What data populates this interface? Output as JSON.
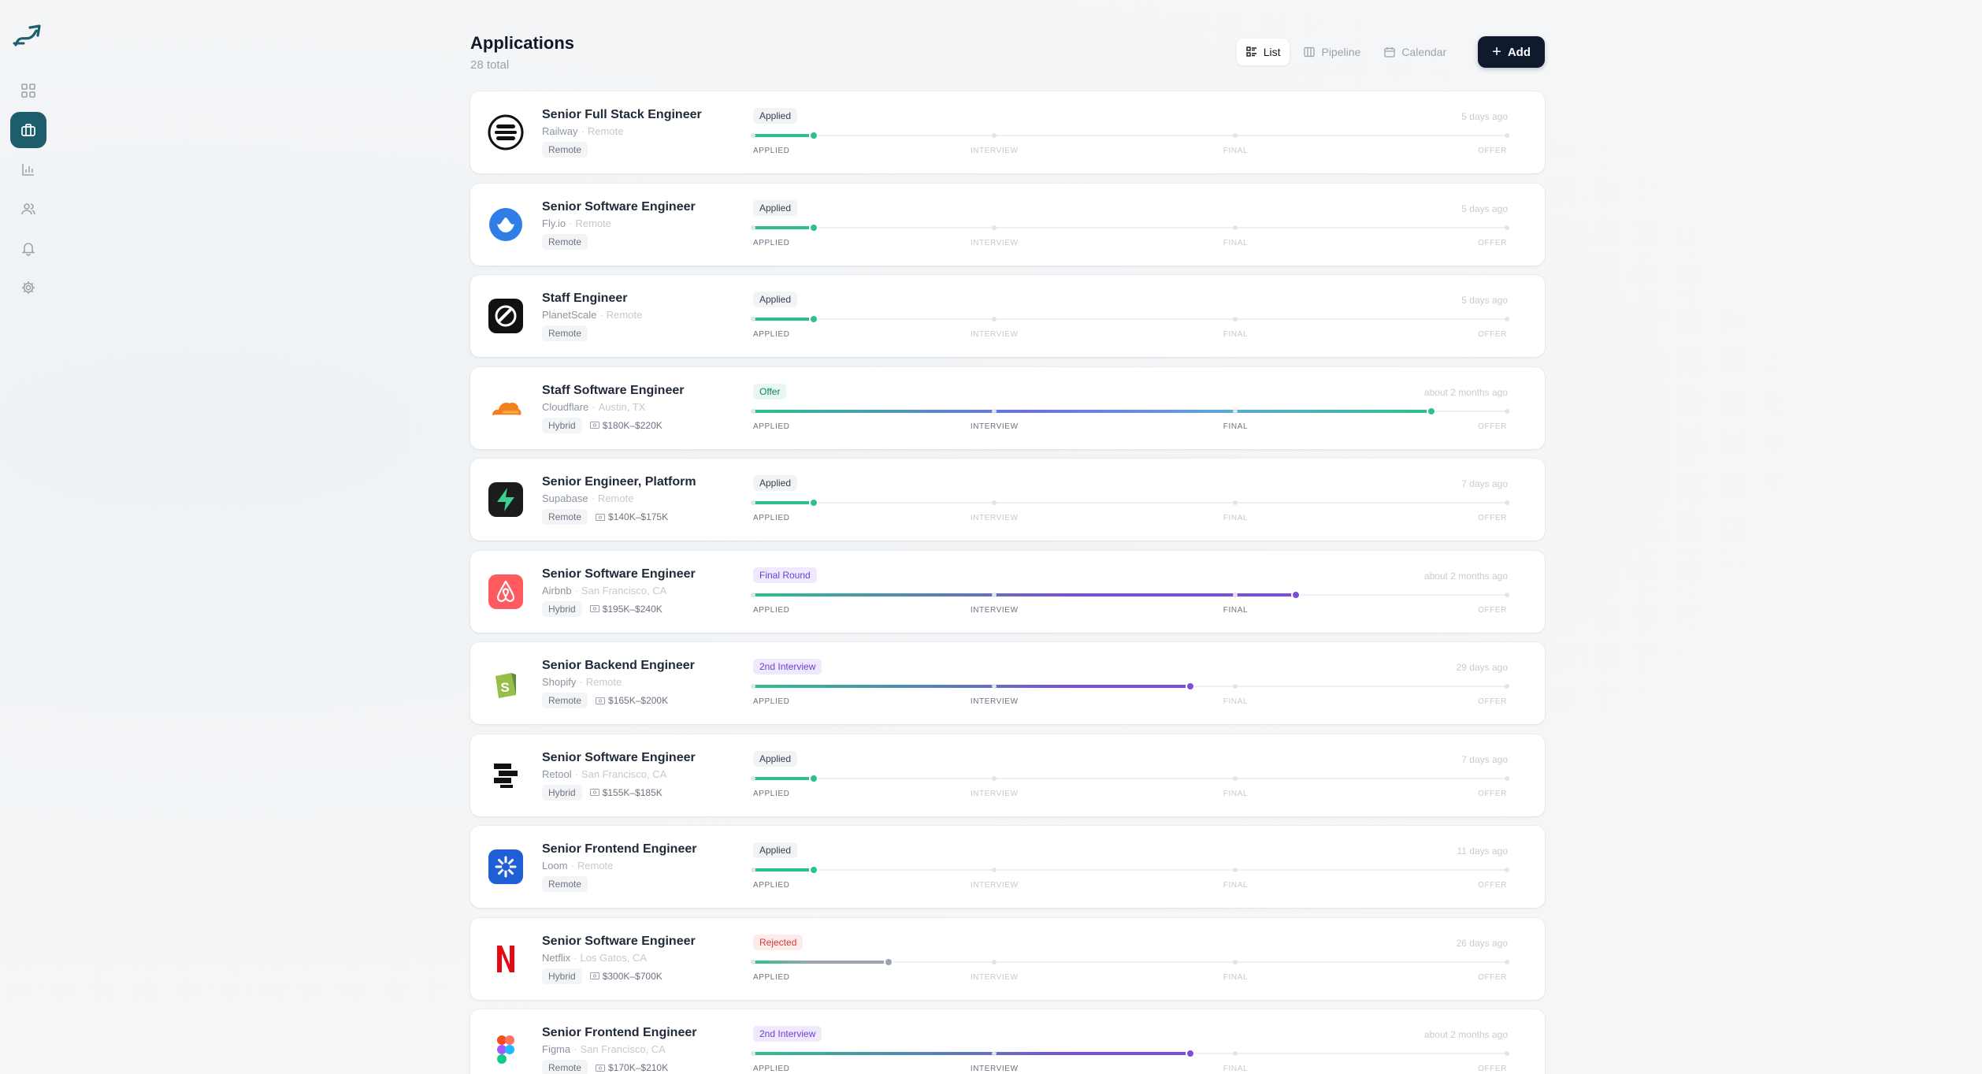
{
  "header": {
    "title": "Applications",
    "subtitle": "28 total",
    "views": [
      "List",
      "Pipeline",
      "Calendar"
    ],
    "active_view": 0,
    "add_label": "Add"
  },
  "sidebar": {
    "items": [
      "dashboard-icon",
      "briefcase-icon",
      "bar-chart-icon",
      "users-icon",
      "bell-icon",
      "gear-icon"
    ],
    "active": 1
  },
  "stages": [
    "APPLIED",
    "INTERVIEW",
    "FINAL",
    "OFFER"
  ],
  "colors": {
    "accent": "#1e5d6c",
    "applied": "#2dc08d",
    "interview": "#7c4ddb",
    "offer": "#2dc08d",
    "rejected": "#9aa4b1",
    "button": "#0f1b2d"
  },
  "applications": [
    {
      "title": "Senior Full Stack Engineer",
      "company": "Railway",
      "location": "Remote",
      "tags": [
        "Remote"
      ],
      "salary": "",
      "status": "Applied",
      "status_kind": "applied",
      "time": "5 days ago",
      "logo": "railway",
      "progress": 0.08,
      "stage_done": 1
    },
    {
      "title": "Senior Software Engineer",
      "company": "Fly.io",
      "location": "Remote",
      "tags": [
        "Remote"
      ],
      "salary": "",
      "status": "Applied",
      "status_kind": "applied",
      "time": "5 days ago",
      "logo": "flyio",
      "progress": 0.08,
      "stage_done": 1
    },
    {
      "title": "Staff Engineer",
      "company": "PlanetScale",
      "location": "Remote",
      "tags": [
        "Remote"
      ],
      "salary": "",
      "status": "Applied",
      "status_kind": "applied",
      "time": "5 days ago",
      "logo": "planetscale",
      "progress": 0.08,
      "stage_done": 1
    },
    {
      "title": "Staff Software Engineer",
      "company": "Cloudflare",
      "location": "Austin, TX",
      "tags": [
        "Hybrid"
      ],
      "salary": "$180K–$220K",
      "status": "Offer",
      "status_kind": "offer",
      "time": "about 2 months ago",
      "logo": "cloudflare",
      "progress": 0.9,
      "stage_done": 3
    },
    {
      "title": "Senior Engineer, Platform",
      "company": "Supabase",
      "location": "Remote",
      "tags": [
        "Remote"
      ],
      "salary": "$140K–$175K",
      "status": "Applied",
      "status_kind": "applied",
      "time": "7 days ago",
      "logo": "supabase",
      "progress": 0.08,
      "stage_done": 1
    },
    {
      "title": "Senior Software Engineer",
      "company": "Airbnb",
      "location": "San Francisco, CA",
      "tags": [
        "Hybrid"
      ],
      "salary": "$195K–$240K",
      "status": "Final Round",
      "status_kind": "final",
      "time": "about 2 months ago",
      "logo": "airbnb",
      "progress": 0.72,
      "stage_done": 3
    },
    {
      "title": "Senior Backend Engineer",
      "company": "Shopify",
      "location": "Remote",
      "tags": [
        "Remote"
      ],
      "salary": "$165K–$200K",
      "status": "2nd Interview",
      "status_kind": "interview",
      "time": "29 days ago",
      "logo": "shopify",
      "progress": 0.58,
      "stage_done": 2
    },
    {
      "title": "Senior Software Engineer",
      "company": "Retool",
      "location": "San Francisco, CA",
      "tags": [
        "Hybrid"
      ],
      "salary": "$155K–$185K",
      "status": "Applied",
      "status_kind": "applied",
      "time": "7 days ago",
      "logo": "retool",
      "progress": 0.08,
      "stage_done": 1
    },
    {
      "title": "Senior Frontend Engineer",
      "company": "Loom",
      "location": "Remote",
      "tags": [
        "Remote"
      ],
      "salary": "",
      "status": "Applied",
      "status_kind": "applied",
      "time": "11 days ago",
      "logo": "loom",
      "progress": 0.08,
      "stage_done": 1
    },
    {
      "title": "Senior Software Engineer",
      "company": "Netflix",
      "location": "Los Gatos, CA",
      "tags": [
        "Hybrid"
      ],
      "salary": "$300K–$700K",
      "status": "Rejected",
      "status_kind": "rejected",
      "time": "26 days ago",
      "logo": "netflix",
      "progress": 0.18,
      "stage_done": 1
    },
    {
      "title": "Senior Frontend Engineer",
      "company": "Figma",
      "location": "San Francisco, CA",
      "tags": [
        "Remote"
      ],
      "salary": "$170K–$210K",
      "status": "2nd Interview",
      "status_kind": "interview",
      "time": "about 2 months ago",
      "logo": "figma",
      "progress": 0.58,
      "stage_done": 2
    }
  ]
}
